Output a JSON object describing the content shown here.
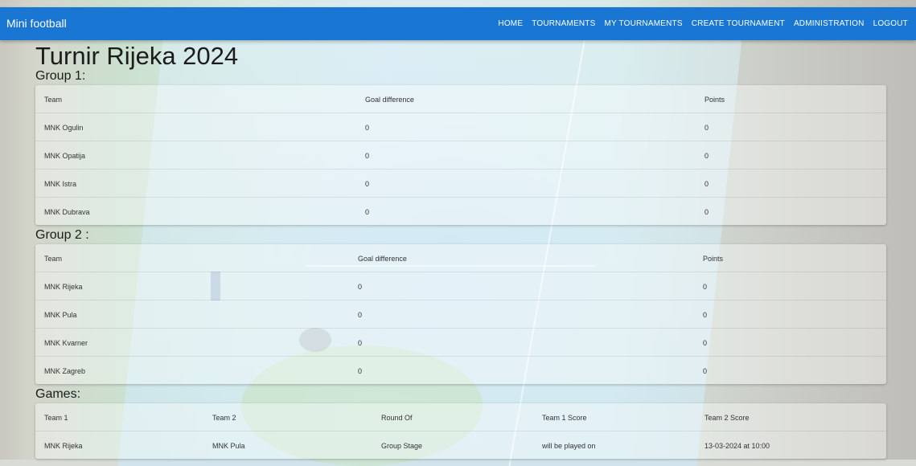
{
  "navbar": {
    "brand": "Mini football",
    "links": [
      "HOME",
      "TOURNAMENTS",
      "MY TOURNAMENTS",
      "CREATE TOURNAMENT",
      "ADMINISTRATION",
      "LOGOUT"
    ]
  },
  "page": {
    "title": "Turnir Rijeka 2024"
  },
  "groups": [
    {
      "heading": "Group 1:",
      "columns": [
        "Team",
        "Goal difference",
        "Points"
      ],
      "rows": [
        [
          "MNK Ogulin",
          "0",
          "0"
        ],
        [
          "MNK Opatija",
          "0",
          "0"
        ],
        [
          "MNK Istra",
          "0",
          "0"
        ],
        [
          "MNK Dubrava",
          "0",
          "0"
        ]
      ]
    },
    {
      "heading": "Group 2 :",
      "columns": [
        "Team",
        "Goal difference",
        "Points"
      ],
      "rows": [
        [
          "MNK Rijeka",
          "0",
          "0"
        ],
        [
          "MNK Pula",
          "0",
          "0"
        ],
        [
          "MNK Kvarner",
          "0",
          "0"
        ],
        [
          "MNK Zagreb",
          "0",
          "0"
        ]
      ]
    }
  ],
  "games": {
    "heading": "Games:",
    "columns": [
      "Team 1",
      "Team 2",
      "Round Of",
      "Team 1 Score",
      "Team 2 Score"
    ],
    "rows": [
      [
        "MNK Rijeka",
        "MNK Pula",
        "Group Stage",
        "will be played on",
        "13-03-2024 at 10:00"
      ]
    ]
  }
}
